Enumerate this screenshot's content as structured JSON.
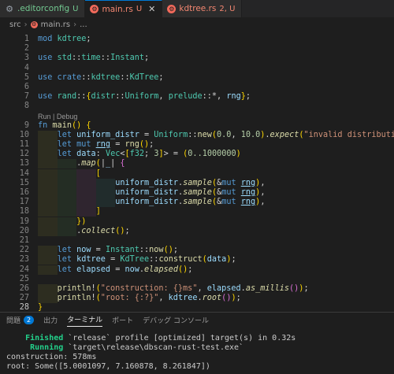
{
  "tabs": [
    {
      "label": ".editorconfig",
      "status": "U",
      "kind": "mod",
      "icon": "gear-icon"
    },
    {
      "label": "main.rs",
      "status": "U",
      "kind": "err",
      "icon": "rust-icon",
      "active": true
    },
    {
      "label": "kdtree.rs",
      "status": "2, U",
      "kind": "err",
      "icon": "rust-icon"
    }
  ],
  "breadcrumb": {
    "folder": "src",
    "file": "main.rs",
    "more": "..."
  },
  "codelens": "Run | Debug",
  "line_numbers": [
    "1",
    "2",
    "3",
    "4",
    "5",
    "6",
    "7",
    "8",
    "9",
    "10",
    "11",
    "12",
    "13",
    "14",
    "15",
    "16",
    "17",
    "18",
    "19",
    "20",
    "21",
    "22",
    "23",
    "24",
    "25",
    "26",
    "27",
    "28"
  ],
  "code_lines": [
    "mod kdtree;",
    "",
    "use std::time::Instant;",
    "",
    "use crate::kdtree::KdTree;",
    "",
    "use rand::{distr::Uniform, prelude::*, rng};",
    "",
    "fn main() {",
    "    let uniform_distr = Uniform::new(0.0, 10.0).expect(\"invalid distribution\");",
    "    let mut rng = rng();",
    "    let data: Vec<[f32; 3]> = (0..1000000)",
    "        .map(|_| {",
    "            [",
    "                uniform_distr.sample(&mut rng),",
    "                uniform_distr.sample(&mut rng),",
    "                uniform_distr.sample(&mut rng),",
    "            ]",
    "        })",
    "        .collect();",
    "",
    "    let now = Instant::now();",
    "    let kdtree = KdTree::construct(data);",
    "    let elapsed = now.elapsed();",
    "",
    "    println!(\"construction: {}ms\", elapsed.as_millis());",
    "    println!(\"root: {:?}\", kdtree.root());",
    "}"
  ],
  "panel_tabs": [
    {
      "label": "問題",
      "badge": "2"
    },
    {
      "label": "出力"
    },
    {
      "label": "ターミナル",
      "active": true
    },
    {
      "label": "ポート"
    },
    {
      "label": "デバッグ コンソール"
    }
  ],
  "terminal": [
    {
      "status": "Finished",
      "text": " `release` profile [optimized] target(s) in 0.32s",
      "indent": "    "
    },
    {
      "status": "Running",
      "text": " `target\\release\\dbscan-rust-test.exe`",
      "indent": "     "
    },
    {
      "status": "",
      "text": "construction: 578ms",
      "indent": ""
    },
    {
      "status": "",
      "text": "root: Some([5.0001097, 7.160878, 8.261847])",
      "indent": ""
    }
  ]
}
